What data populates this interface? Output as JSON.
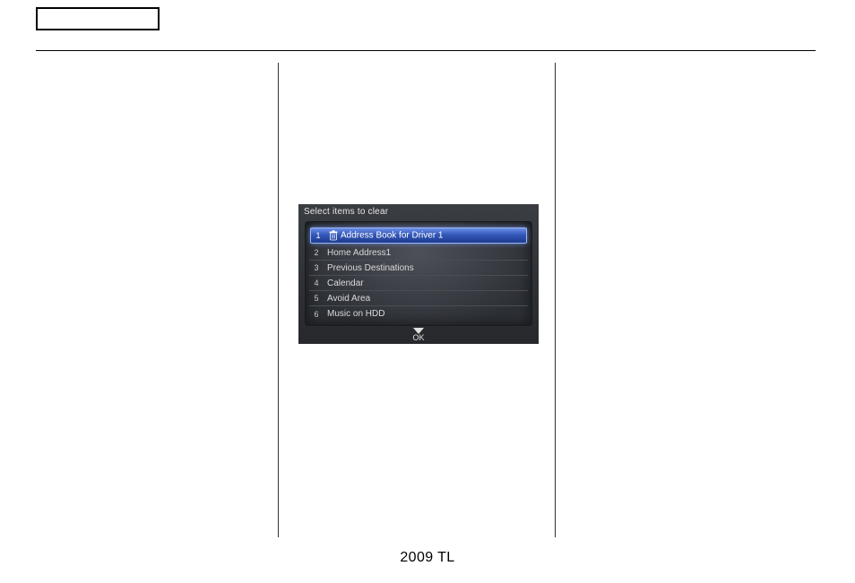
{
  "device": {
    "title": "Select items to clear",
    "rows": [
      {
        "num": "1",
        "label": "Address Book for Driver 1",
        "highlight": true
      },
      {
        "num": "2",
        "label": "Home Address1",
        "highlight": false
      },
      {
        "num": "3",
        "label": "Previous Destinations",
        "highlight": false
      },
      {
        "num": "4",
        "label": "Calendar",
        "highlight": false
      },
      {
        "num": "5",
        "label": "Avoid Area",
        "highlight": false
      },
      {
        "num": "6",
        "label": "Music on HDD",
        "highlight": false
      }
    ],
    "ok": "OK"
  },
  "footer": "2009  TL"
}
